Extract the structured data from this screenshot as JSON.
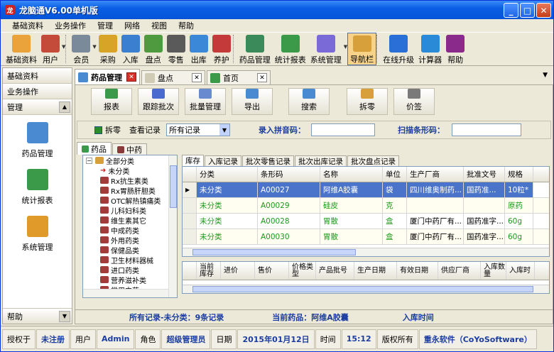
{
  "window": {
    "title": "龙脑通V6.00单机版",
    "app_icon": "龙"
  },
  "menu": [
    "基础资料",
    "业务操作",
    "管理",
    "网络",
    "视图",
    "帮助"
  ],
  "toolbar": [
    {
      "label": "基础资料",
      "icon": "basic-data-icon",
      "color": "#e9a33a"
    },
    {
      "label": "用户",
      "icon": "user-icon",
      "color": "#c44b3a"
    },
    {
      "label": "会员",
      "icon": "member-icon",
      "color": "#7a8a9a"
    },
    {
      "label": "采购",
      "icon": "purchase-icon",
      "color": "#d8a427"
    },
    {
      "label": "入库",
      "icon": "stock-in-icon",
      "color": "#3b7fd0"
    },
    {
      "label": "盘点",
      "icon": "inventory-check-icon",
      "color": "#4f9a3f"
    },
    {
      "label": "零售",
      "icon": "retail-icon",
      "color": "#5a5a5a"
    },
    {
      "label": "出库",
      "icon": "stock-out-icon",
      "color": "#3b88d8"
    },
    {
      "label": "养护",
      "icon": "maintenance-icon",
      "color": "#c43a3a"
    },
    {
      "label": "药品管理",
      "icon": "drug-management-icon",
      "color": "#3a8a5a"
    },
    {
      "label": "统计报表",
      "icon": "report-icon",
      "color": "#3a9a4a"
    },
    {
      "label": "系统管理",
      "icon": "system-icon",
      "color": "#7a6ad8"
    },
    {
      "label": "导航栏",
      "icon": "navbar-icon",
      "color": "#d8a03a"
    },
    {
      "label": "在线升级",
      "icon": "online-upgrade-icon",
      "color": "#2a6fd8"
    },
    {
      "label": "计算器",
      "icon": "calculator-icon",
      "color": "#2a8ad8"
    },
    {
      "label": "帮助",
      "icon": "help-book-icon",
      "color": "#8a2a8a"
    }
  ],
  "sidebar": {
    "sections": [
      "基础资料",
      "业务操作",
      "管理"
    ],
    "items": [
      {
        "label": "药品管理",
        "icon": "drug-management-icon",
        "color": "#4a8ad0"
      },
      {
        "label": "统计报表",
        "icon": "report-icon",
        "color": "#3a9a4a"
      },
      {
        "label": "系统管理",
        "icon": "system-icon",
        "color": "#e09a2a"
      }
    ],
    "bottom": "帮助"
  },
  "doc_tabs": [
    {
      "label": "药品管理",
      "active": true,
      "icon": "drug-tab-icon",
      "color": "#4a8ad0"
    },
    {
      "label": "盘点",
      "active": false,
      "icon": "inventory-tab-icon",
      "color": "#cfcbb5"
    },
    {
      "label": "首页",
      "active": false,
      "icon": "home-tab-icon",
      "color": "#3a9a4a"
    }
  ],
  "actions": [
    {
      "label": "报表",
      "icon": "report-icon",
      "color": "#3a9a4a"
    },
    {
      "label": "跟踪批次",
      "icon": "track-batch-icon",
      "color": "#4a6ad0"
    },
    {
      "label": "批量管理",
      "icon": "batch-manage-icon",
      "color": "#6a8ad0"
    },
    {
      "label": "导出",
      "icon": "export-icon",
      "color": "#4a8ad0"
    },
    {
      "label": "搜索",
      "icon": "search-icon",
      "color": "#4a8ad0"
    },
    {
      "label": "拆零",
      "icon": "split-icon",
      "color": "#d8a03a"
    },
    {
      "label": "价签",
      "icon": "price-tag-icon",
      "color": "#7a7a7a"
    }
  ],
  "filter": {
    "split_label": "拆零",
    "view_label": "查看记录",
    "view_value": "所有记录",
    "pinyin_label": "录入拼音码：",
    "pinyin_value": "",
    "barcode_label": "扫描条形码：",
    "barcode_value": ""
  },
  "subtabs": [
    "药品",
    "中药"
  ],
  "tree": {
    "root": "全部分类",
    "root_toggle": "−",
    "items": [
      "未分类",
      "Rx抗生素类",
      "Rx胃肠肝胆类",
      "OTC解热镇痛类",
      "儿科妇科类",
      "维生素其它",
      "中成药类",
      "外用药类",
      "保健品类",
      "卫生材料器械",
      "进口药类",
      "营养滋补类",
      "常用中药"
    ]
  },
  "grid_tabs": [
    "库存",
    "入库记录",
    "批次零售记录",
    "批次出库记录",
    "批次盘点记录"
  ],
  "grid": {
    "columns": [
      "分类",
      "条形码",
      "名称",
      "单位",
      "生产厂商",
      "批准文号",
      "规格"
    ],
    "rows": [
      {
        "cells": [
          "未分类",
          "A00027",
          "阿维A胶囊",
          "袋",
          "四川维奥制药...",
          "国药准...",
          "10粒*"
        ],
        "selected": true
      },
      {
        "cells": [
          "未分类",
          "A00029",
          "硅皮",
          "克",
          "",
          "",
          "原药"
        ],
        "selected": false
      },
      {
        "cells": [
          "未分类",
          "A00028",
          "胃散",
          "盒",
          "厦门中药厂有...",
          "国药准字...",
          "60g"
        ],
        "selected": false
      },
      {
        "cells": [
          "未分类",
          "A00030",
          "胃散",
          "盒",
          "厦门中药厂有...",
          "国药准字...",
          "60g"
        ],
        "selected": false
      }
    ]
  },
  "grid2": {
    "columns": [
      "当前库存",
      "进价",
      "售价",
      "价格类型",
      "产品批号",
      "生产日期",
      "有效日期",
      "供应厂商",
      "入库数量",
      "入库时"
    ]
  },
  "status": {
    "records": "所有记录-未分类：9条记录",
    "current": "当前药品：阿维A胶囊",
    "in_time": "入库时间"
  },
  "bottom": [
    {
      "k": "授权于",
      "v": "未注册"
    },
    {
      "k": "用户",
      "v": "Admin"
    },
    {
      "k": "角色",
      "v": "超级管理员"
    },
    {
      "k": "日期",
      "v": "2015年01月12日"
    },
    {
      "k": "时间",
      "v": "15:12"
    },
    {
      "k": "版权所有",
      "v": "重永软件（CoYoSoftware）"
    }
  ]
}
